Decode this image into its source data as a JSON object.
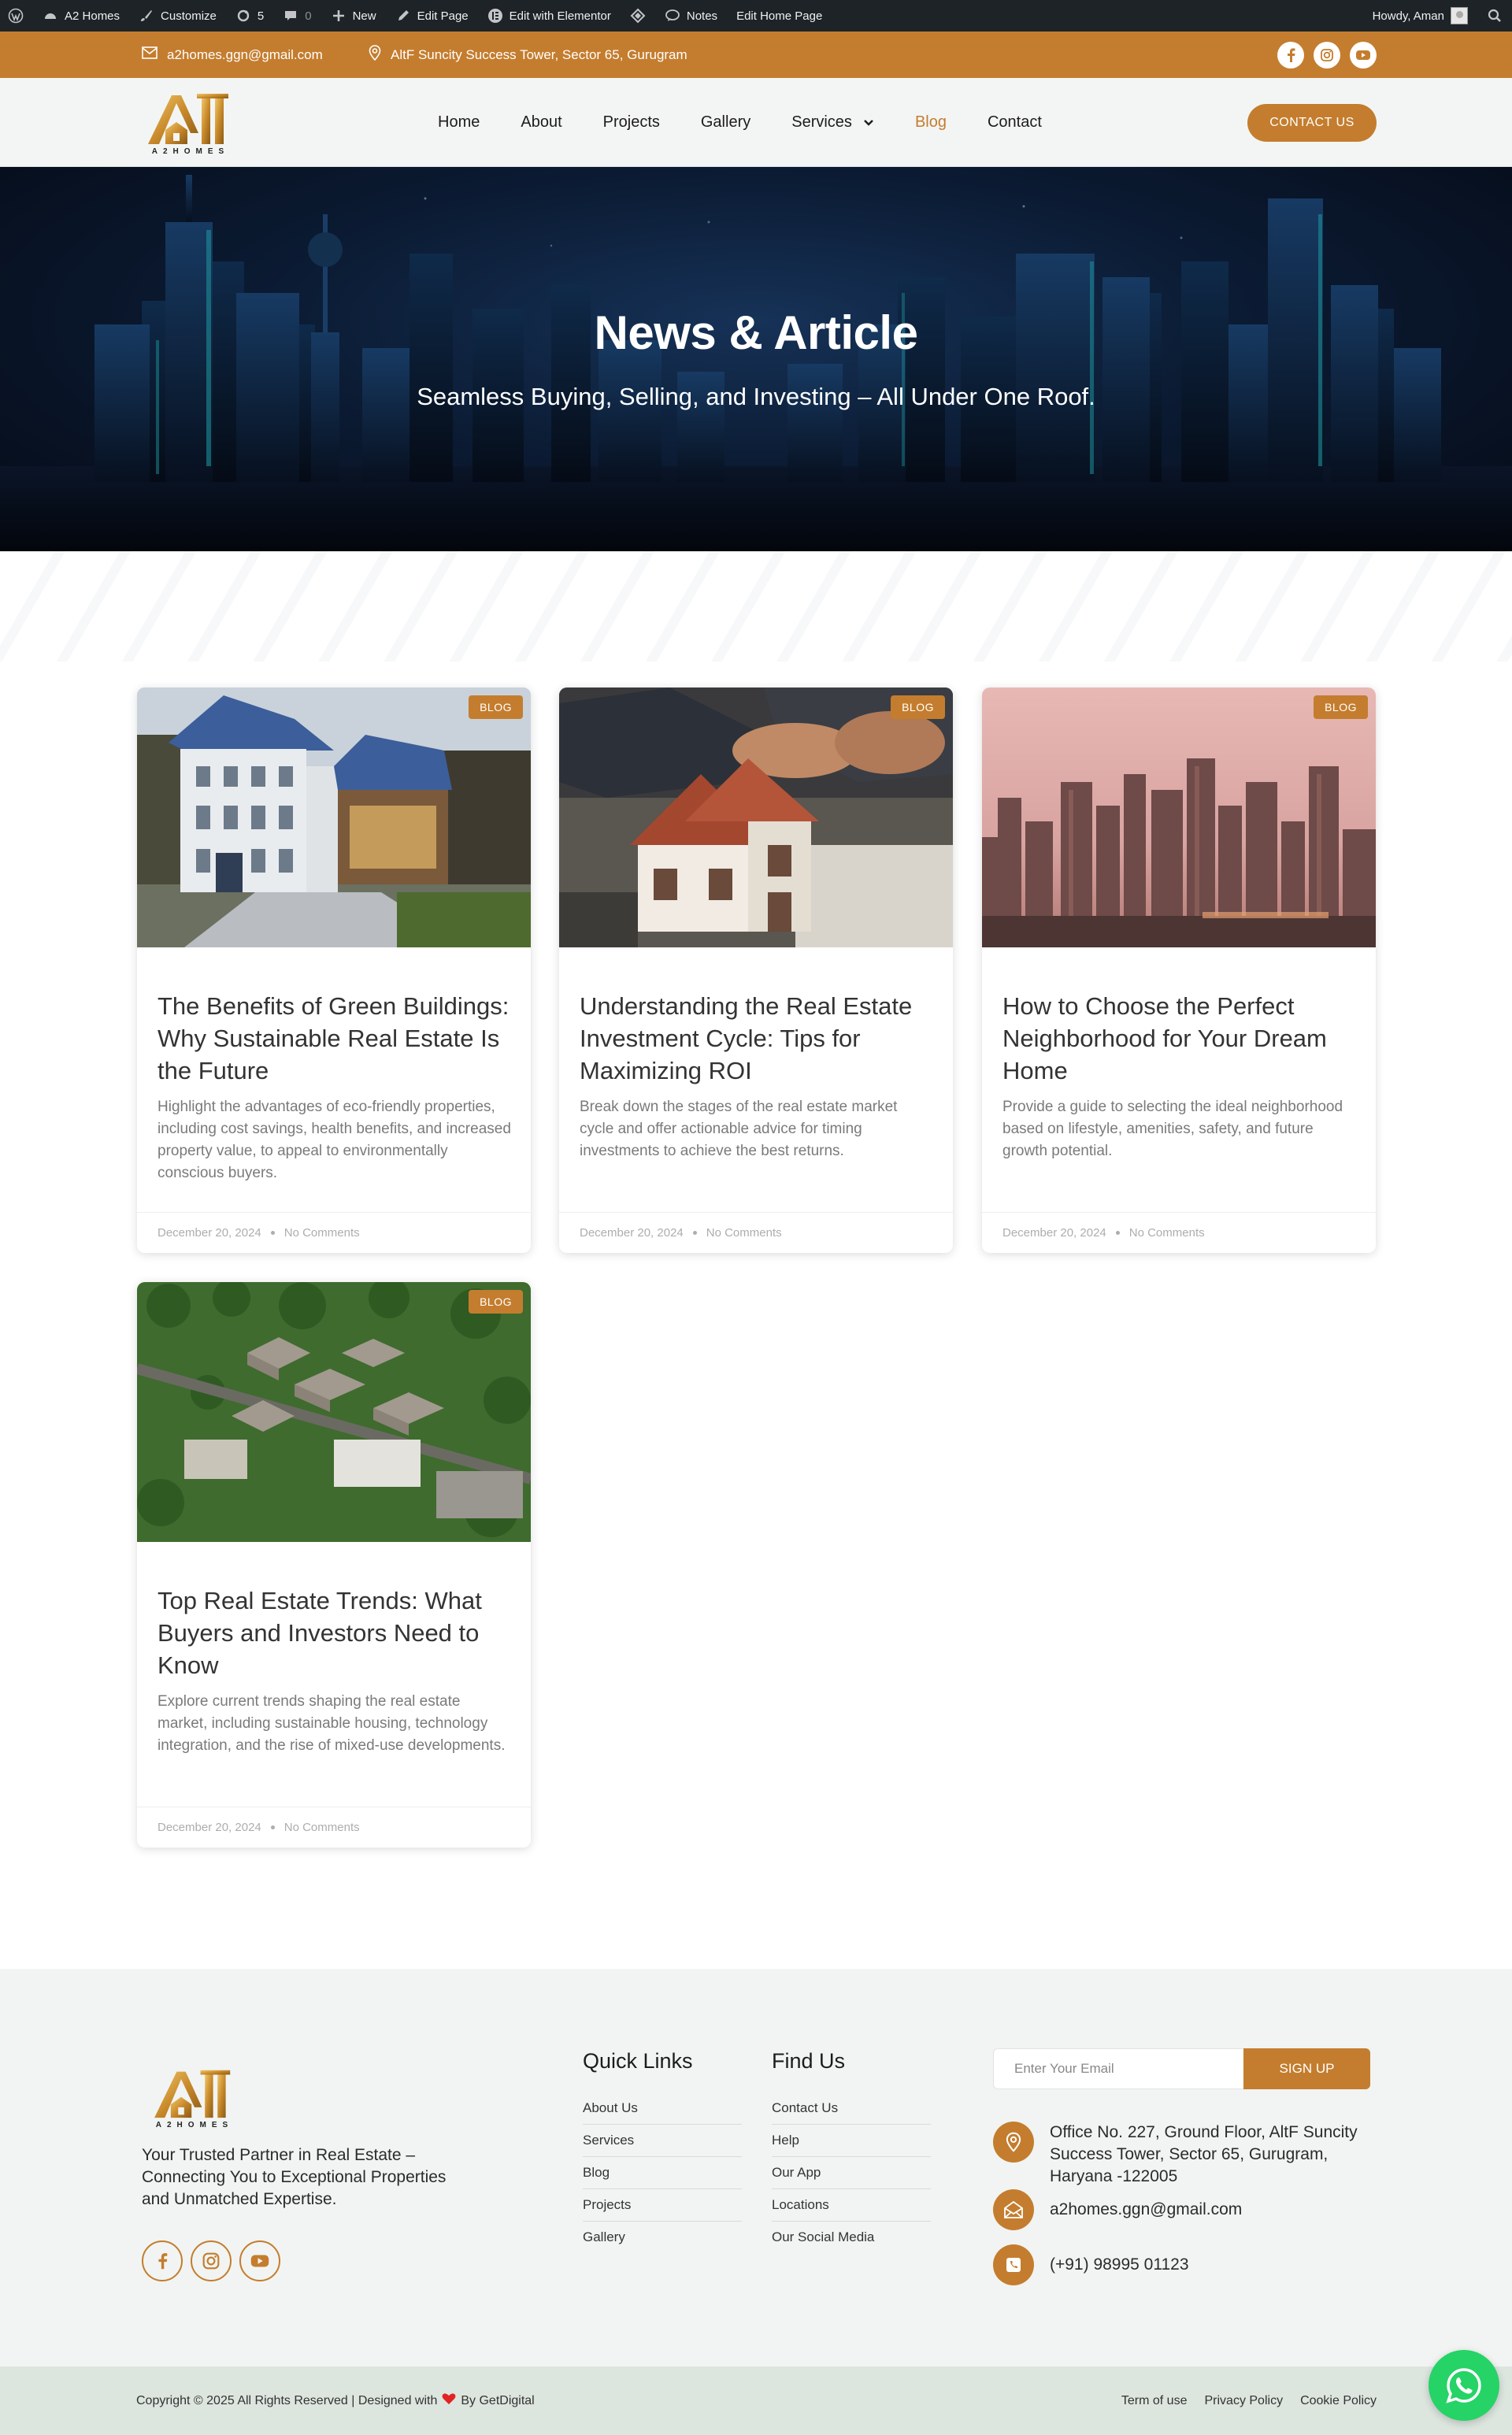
{
  "admin_bar": {
    "site_name": "A2 Homes",
    "customize": "Customize",
    "updates_count": "5",
    "comments_count": "0",
    "new_label": "New",
    "edit_page": "Edit Page",
    "edit_elementor": "Edit with Elementor",
    "notes": "Notes",
    "edit_home_page": "Edit Home Page",
    "howdy": "Howdy, Aman"
  },
  "top_strip": {
    "email": "a2homes.ggn@gmail.com",
    "address": "AltF Suncity Success Tower, Sector 65, Gurugram",
    "social": [
      "facebook-icon",
      "instagram-icon",
      "youtube-icon"
    ]
  },
  "header": {
    "logo_letters": "A",
    "logo_text": "A2HOMES",
    "nav": [
      {
        "label": "Home"
      },
      {
        "label": "About"
      },
      {
        "label": "Projects"
      },
      {
        "label": "Gallery"
      },
      {
        "label": "Services"
      },
      {
        "label": "Blog"
      },
      {
        "label": "Contact"
      }
    ],
    "cta": "CONTACT US"
  },
  "hero": {
    "title": "News & Article",
    "subtitle": "Seamless Buying, Selling, and Investing – All Under One Roof."
  },
  "posts": [
    {
      "badge": "BLOG",
      "title": "The Benefits of Green Buildings: Why Sustainable Real Estate Is the Future",
      "excerpt": "Highlight the advantages of eco-friendly properties, including cost savings, health benefits, and increased property value, to appeal to environmentally conscious buyers.",
      "date": "December 20, 2024",
      "comments": "No Comments"
    },
    {
      "badge": "BLOG",
      "title": "Understanding the Real Estate Investment Cycle: Tips for Maximizing ROI",
      "excerpt": "Break down the stages of the real estate market cycle and offer actionable advice for timing investments to achieve the best returns.",
      "date": "December 20, 2024",
      "comments": "No Comments"
    },
    {
      "badge": "BLOG",
      "title": "How to Choose the Perfect Neighborhood for Your Dream Home",
      "excerpt": "Provide a guide to selecting the ideal neighborhood based on lifestyle, amenities, safety, and future growth potential.",
      "date": "December 20, 2024",
      "comments": "No Comments"
    },
    {
      "badge": "BLOG",
      "title": "Top Real Estate Trends: What Buyers and Investors Need to Know",
      "excerpt": "Explore current trends shaping the real estate market, including sustainable housing, technology integration, and the rise of mixed-use developments.",
      "date": "December 20, 2024",
      "comments": "No Comments"
    }
  ],
  "footer": {
    "tagline": "Your Trusted Partner in Real Estate – Connecting You to Exceptional Properties and Unmatched Expertise.",
    "quick_links": {
      "heading": "Quick Links",
      "items": [
        "About Us",
        "Services",
        "Blog",
        "Projects",
        "Gallery"
      ]
    },
    "find_us": {
      "heading": "Find Us",
      "items": [
        "Contact Us",
        "Help",
        "Our App",
        "Locations",
        "Our Social Media"
      ]
    },
    "newsletter": {
      "placeholder": "Enter Your Email",
      "button": "SIGN UP"
    },
    "address": "Office No. 227, Ground Floor, AltF Suncity Success Tower, Sector 65, Gurugram, Haryana -122005",
    "email": "a2homes.ggn@gmail.com",
    "phone": "(+91) 98995 01123"
  },
  "bottom_bar": {
    "copyright": "Copyright © 2025 All Rights Reserved | Designed with",
    "by": "By GetDigital",
    "legal": [
      "Term of use",
      "Privacy Policy",
      "Cookie Policy"
    ]
  },
  "colors": {
    "accent": "#c47d2e",
    "admin_bar": "#1d2327",
    "footer_bg": "#f1f4f2",
    "whatsapp": "#25d366"
  }
}
